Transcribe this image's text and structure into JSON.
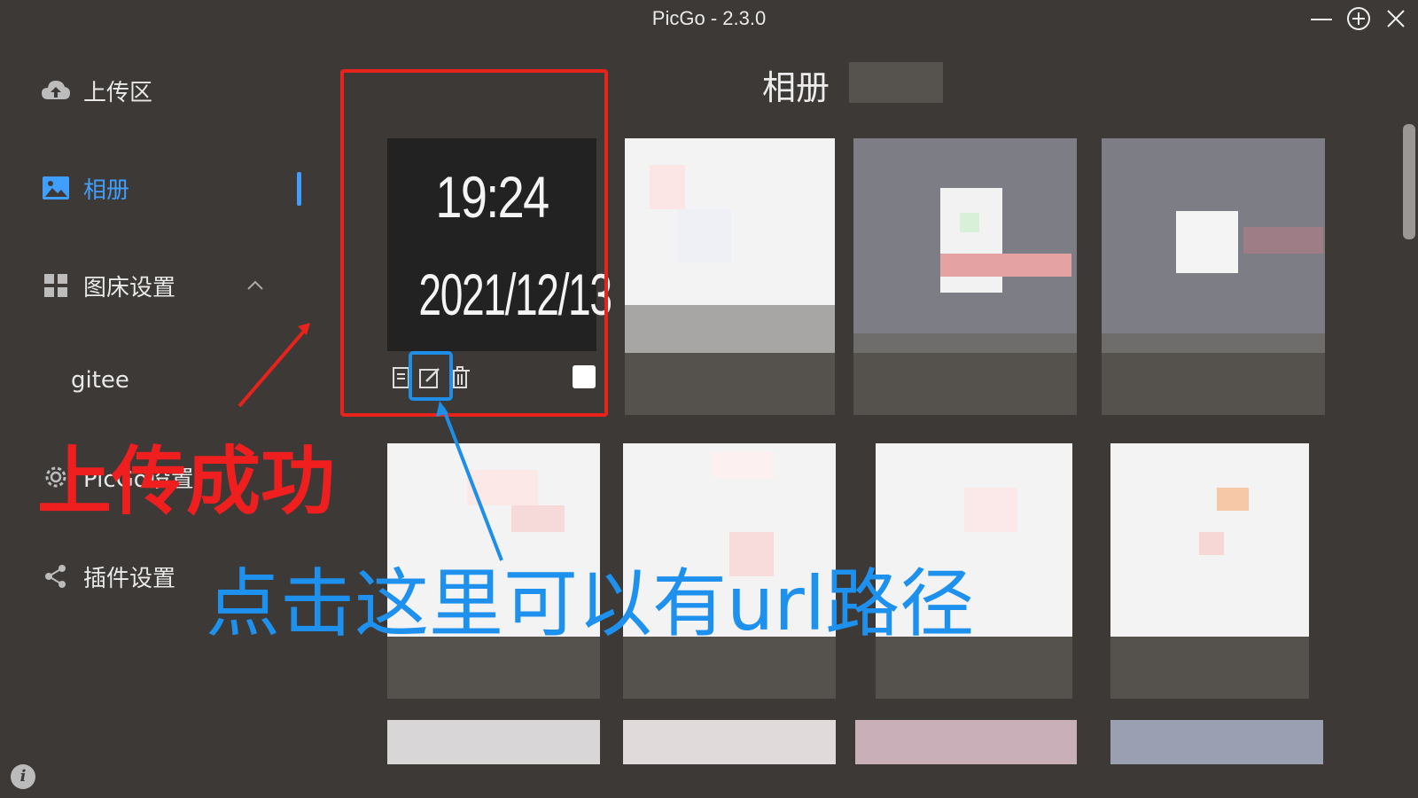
{
  "window": {
    "title": "PicGo - 2.3.0",
    "minimize_icon": "minimize-icon",
    "maximize_icon": "plus-circle-icon",
    "close_icon": "close-icon"
  },
  "sidebar": {
    "items": [
      {
        "label": "上传区",
        "icon": "cloud-upload-icon"
      },
      {
        "label": "相册",
        "icon": "image-icon",
        "active": true
      },
      {
        "label": "图床设置",
        "icon": "grid-icon",
        "expanded": true
      },
      {
        "label": "PicGo设置",
        "icon": "gear-icon"
      },
      {
        "label": "插件设置",
        "icon": "share-icon"
      }
    ],
    "sub_items": [
      {
        "label": "gitee"
      }
    ],
    "info_icon": "info-icon",
    "info_label": "i"
  },
  "main": {
    "title": "相册",
    "first_image": {
      "time": "19:24",
      "date": "2021/12/13"
    }
  },
  "annotations": {
    "red_text": "上传成功",
    "blue_text": "点击这里可以有url路径"
  },
  "colors": {
    "accent": "#409eff",
    "annotation_red": "#e8231c",
    "annotation_blue": "#1e8ee8",
    "background": "#3c3936"
  }
}
